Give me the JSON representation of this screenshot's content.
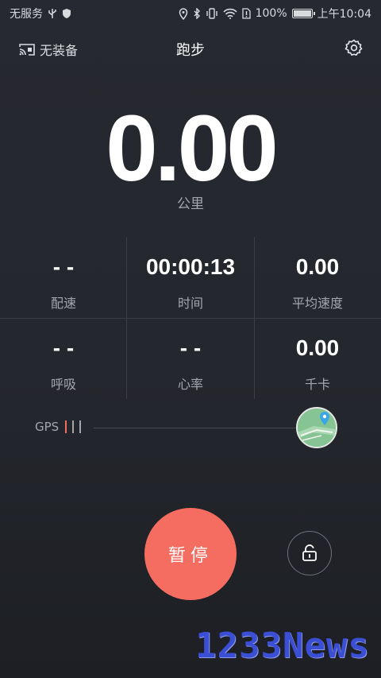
{
  "status_bar": {
    "carrier": "无服务",
    "battery_percent": "100%",
    "battery_level": 1.0,
    "time": "上午10:04",
    "icons": [
      "usb-icon",
      "shield-icon",
      "location-icon",
      "bluetooth-icon",
      "vibrate-icon",
      "wifi-icon",
      "sim-alert-icon",
      "battery-icon"
    ]
  },
  "header": {
    "device_label": "无装备",
    "device_icon": "cast-icon",
    "title": "跑步",
    "settings_icon": "gear-icon"
  },
  "distance": {
    "value": "0.00",
    "unit": "公里"
  },
  "metrics": [
    {
      "id": "pace",
      "value": "- -",
      "label": "配速"
    },
    {
      "id": "time",
      "value": "00:00:13",
      "label": "时间"
    },
    {
      "id": "avg-speed",
      "value": "0.00",
      "label": "平均速度"
    },
    {
      "id": "breathing",
      "value": "- -",
      "label": "呼吸"
    },
    {
      "id": "heart-rate",
      "value": "- -",
      "label": "心率"
    },
    {
      "id": "calories",
      "value": "0.00",
      "label": "千卡"
    }
  ],
  "gps": {
    "label": "GPS",
    "signal_bars": 3,
    "active_bars": 1,
    "weak_color": "#f26d62"
  },
  "map_button": {
    "icon": "map-pin-icon"
  },
  "controls": {
    "pause_label": "暂停",
    "pause_color": "#f56d61",
    "lock_icon": "unlock-icon"
  },
  "watermark": {
    "text": "1233News"
  }
}
